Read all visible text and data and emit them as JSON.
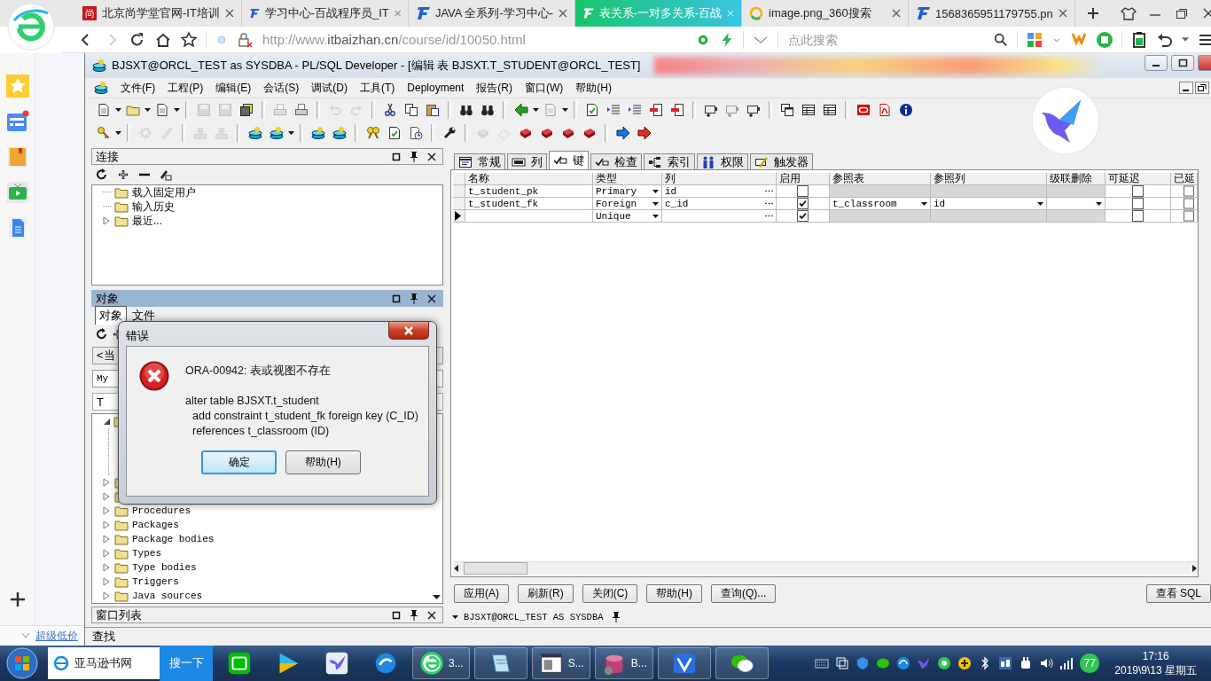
{
  "browser": {
    "tabs": [
      {
        "title": "北京尚学堂官网-IT培训",
        "kind": "shang",
        "badge": "尚",
        "selected": false
      },
      {
        "title": "学习中心-百战程序员_IT",
        "kind": "itbaizhan",
        "selected": false
      },
      {
        "title": "JAVA 全系列-学习中心-",
        "kind": "itbaizhan",
        "selected": false
      },
      {
        "title": "表关系-一对多关系-百战",
        "kind": "itbaizhan",
        "selected": true
      },
      {
        "title": "image.png_360搜索",
        "kind": "search360",
        "selected": false
      },
      {
        "title": "1568365951179755.pn",
        "kind": "itbaizhan",
        "selected": false
      }
    ],
    "url": {
      "scheme": "http://www.",
      "domain": "itbaizhan.cn",
      "path": "/course/id/10050.html"
    },
    "search": {
      "placeholder": "点此搜索"
    },
    "promo": "超级低价"
  },
  "app": {
    "title": "BJSXT@ORCL_TEST as SYSDBA - PL/SQL Developer - [编辑 表 BJSXT.T_STUDENT@ORCL_TEST]",
    "menu": [
      "文件(F)",
      "工程(P)",
      "编辑(E)",
      "会话(S)",
      "调试(D)",
      "工具(T)",
      "Deployment",
      "报告(R)",
      "窗口(W)",
      "帮助(H)"
    ],
    "connections": {
      "title": "连接",
      "active": false,
      "items": [
        {
          "label": "载入固定用户",
          "expandable": false
        },
        {
          "label": "输入历史",
          "expandable": false
        },
        {
          "label": "最近...",
          "expandable": true
        }
      ]
    },
    "objects": {
      "title": "对象",
      "active": true,
      "tabs": [
        {
          "label": "对象",
          "selected": true
        },
        {
          "label": "文件",
          "selected": false
        }
      ],
      "owner_filter": "<当",
      "type_filter": "My",
      "search": "T",
      "items": [
        {
          "label": "Procedures"
        },
        {
          "label": "Packages"
        },
        {
          "label": "Package bodies"
        },
        {
          "label": "Types"
        },
        {
          "label": "Type bodies"
        },
        {
          "label": "Triggers"
        },
        {
          "label": "Java sources"
        }
      ]
    },
    "window_list": {
      "title": "窗口列表",
      "active": false
    },
    "find": "查找",
    "editor": {
      "tabs": [
        {
          "label": "常规",
          "kind": "general",
          "selected": false
        },
        {
          "label": "列",
          "kind": "columns",
          "selected": false
        },
        {
          "label": "键",
          "kind": "keys",
          "selected": true
        },
        {
          "label": "检查",
          "kind": "checks",
          "selected": false
        },
        {
          "label": "索引",
          "kind": "indexes",
          "selected": false
        },
        {
          "label": "权限",
          "kind": "privileges",
          "selected": false
        },
        {
          "label": "触发器",
          "kind": "triggers",
          "selected": false
        }
      ],
      "columns": [
        "名称",
        "类型",
        "列",
        "启用",
        "参照表",
        "参照列",
        "级联删除",
        "可延迟",
        "已延"
      ],
      "rows": [
        {
          "name": "t_student_pk",
          "type": "Primary",
          "columns": "id",
          "enabled": false,
          "reference_disabled": true,
          "deferrable": false,
          "deferred": false,
          "current": false
        },
        {
          "name": "t_student_fk",
          "type": "Foreign",
          "columns": "c_id",
          "enabled": true,
          "ref_table": "t_classroom",
          "ref_column": "id",
          "reference_disabled": false,
          "deferrable": false,
          "deferred": false,
          "current": false
        },
        {
          "type": "Unique",
          "enabled": true,
          "reference_disabled": true,
          "deferrable": false,
          "deferred": false,
          "current": true
        }
      ],
      "buttons": [
        "应用(A)",
        "刷新(R)",
        "关闭(C)",
        "帮助(H)",
        "查询(Q)..."
      ],
      "view_sql": "查看 SQL",
      "status": "BJSXT@ORCL_TEST AS SYSDBA"
    }
  },
  "dialog": {
    "title": "错误",
    "message": "ORA-00942: 表或视图不存在",
    "detail": [
      {
        "text": "alter table BJSXT.t_student",
        "kind": "head"
      },
      {
        "text": "add constraint t_student_fk foreign key (C_ID)",
        "kind": "continuation"
      },
      {
        "text": "references t_classroom (ID)",
        "kind": "continuation"
      }
    ],
    "buttons": [
      {
        "label": "确定",
        "default": true
      },
      {
        "label": "帮助(H)",
        "default": false
      }
    ]
  },
  "taskbar": {
    "search": "亚马逊书网",
    "search_button": "搜一下",
    "items": [
      {
        "kind": "iqiyi",
        "running": false
      },
      {
        "kind": "player",
        "running": false
      },
      {
        "kind": "bird",
        "running": false
      },
      {
        "kind": "bluecircle",
        "running": false
      },
      {
        "kind": "browser",
        "label": "3...",
        "running": true
      },
      {
        "kind": "notepad",
        "running": true
      },
      {
        "kind": "window",
        "label": "S...",
        "running": true
      },
      {
        "kind": "database",
        "label": "B...",
        "running": true
      },
      {
        "kind": "vw",
        "running": true
      },
      {
        "kind": "wechat",
        "running": true
      }
    ],
    "badge": "77",
    "time": "17:16",
    "date": "2019\\9\\13 星期五"
  }
}
